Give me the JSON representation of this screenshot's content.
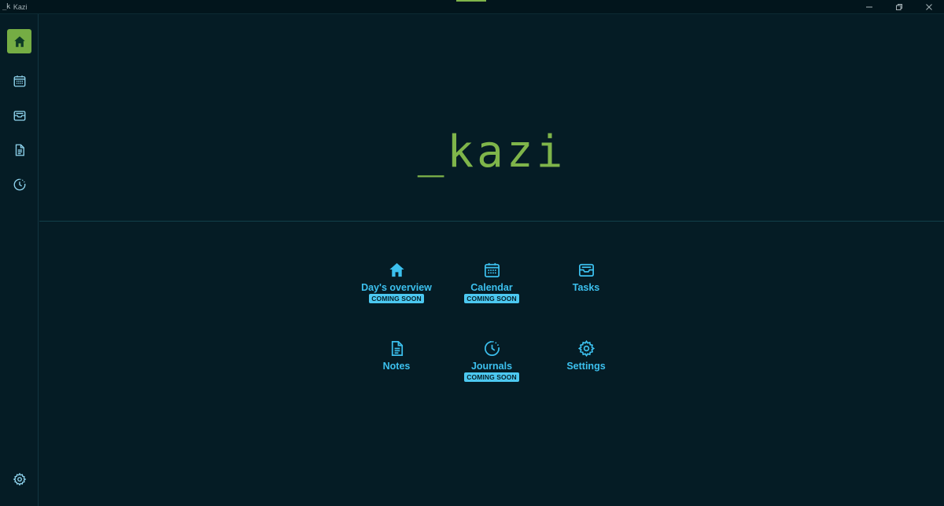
{
  "window": {
    "logo": "_k",
    "title": "Kazi",
    "minimize_icon": "minimize-icon",
    "restore_icon": "restore-icon",
    "close_icon": "close-icon"
  },
  "sidebar": {
    "items": [
      {
        "icon": "home-icon",
        "active": true
      },
      {
        "icon": "calendar-icon",
        "active": false
      },
      {
        "icon": "inbox-icon",
        "active": false
      },
      {
        "icon": "document-icon",
        "active": false
      },
      {
        "icon": "clock-icon",
        "active": false
      }
    ],
    "bottom_item": {
      "icon": "gear-icon"
    }
  },
  "hero": {
    "logo_text": "_kazi"
  },
  "tiles": [
    {
      "label": "Day's overview",
      "badge": "COMING SOON",
      "icon": "home-icon"
    },
    {
      "label": "Calendar",
      "badge": "COMING SOON",
      "icon": "calendar-icon"
    },
    {
      "label": "Tasks",
      "badge": "",
      "icon": "inbox-icon"
    },
    {
      "label": "Notes",
      "badge": "",
      "icon": "document-icon"
    },
    {
      "label": "Journals",
      "badge": "COMING SOON",
      "icon": "clock-icon"
    },
    {
      "label": "Settings",
      "badge": "",
      "icon": "gear-icon"
    }
  ],
  "colors": {
    "background": "#051c25",
    "accent_green": "#7fb54a",
    "accent_blue": "#3cc0ee",
    "sidebar_icon": "#8fd4ee"
  }
}
